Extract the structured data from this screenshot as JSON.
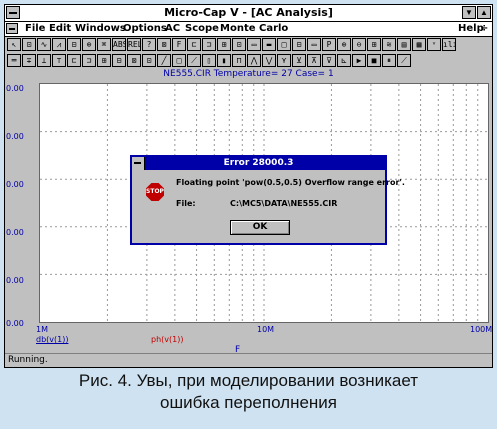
{
  "window": {
    "title": "Micro-Cap V - [AC Analysis]",
    "buttons": [
      "▼",
      "▲"
    ]
  },
  "menu": {
    "items": [
      "File",
      "Edit",
      "Windows",
      "Options",
      "AC",
      "Scope",
      "Monte Carlo"
    ],
    "help": "Help",
    "help_arrow": "÷"
  },
  "toolbar1": [
    "↖",
    "⊡",
    "∿",
    "⩘",
    "⊟",
    "⊕",
    "⌘",
    "ABS",
    "REL",
    "?",
    "⊠",
    "F",
    "⊏",
    "⊐",
    "⊞",
    "⊡",
    "▭",
    "▬",
    "□",
    "⊟",
    "▭",
    "P",
    "⊕",
    "⊖",
    "⊞",
    "≋",
    "▤",
    "▦",
    "ᵛ",
    "ılı"
  ],
  "toolbar2": [
    "═",
    "∓",
    "⊥",
    "⊤",
    "⊏",
    "⊐",
    "⊞",
    "⊟",
    "⊠",
    "⊡",
    "╱",
    "□",
    "⟋",
    "▯",
    "▮",
    "⊓",
    "⋀",
    "⋁",
    "⋎",
    "⊻",
    "⊼",
    "⊽",
    "⊾",
    "▶",
    "■",
    "⏸",
    "⟋"
  ],
  "plot": {
    "subtitle": "NE555.CIR Temperature= 27 Case= 1",
    "y_ticks": [
      "0.00",
      "0.00",
      "0.00",
      "0.00",
      "0.00",
      "0.00"
    ],
    "x_ticks": [
      "1M",
      "10M",
      "100M"
    ],
    "legend": [
      "db(v(1))",
      "ph(v(1))"
    ],
    "legend_colors": [
      "#0000a8",
      "#c00000"
    ],
    "xlabel": "F"
  },
  "dialog": {
    "title": "Error 28000.3",
    "icon_text": "STOP",
    "message": "Floating point 'pow(0.5,0.5) Overflow range error'.",
    "file_label": "File:",
    "file_value": "C:\\MC5\\DATA\\NE555.CIR",
    "ok_label": "OK"
  },
  "status": "Running.",
  "caption": {
    "line1": "Рис. 4. Увы, при моделировании возникает",
    "line2": "ошибка переполнения"
  }
}
